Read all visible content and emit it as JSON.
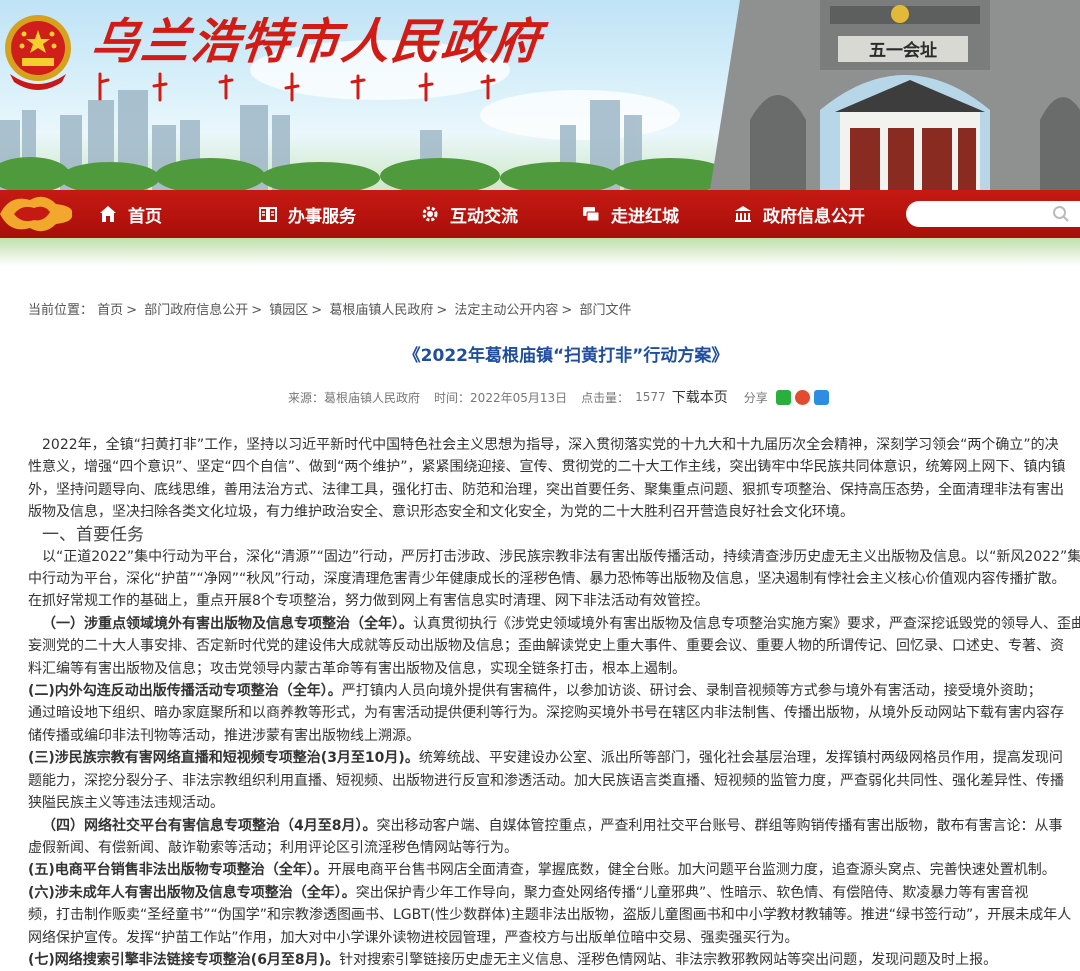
{
  "header": {
    "site_title": "乌兰浩特市人民政府",
    "gate_sign": "五一会址"
  },
  "nav": {
    "items": [
      {
        "label": "首页",
        "icon": "home-icon"
      },
      {
        "label": "办事服务",
        "icon": "book-icon"
      },
      {
        "label": "互动交流",
        "icon": "gear-icon"
      },
      {
        "label": "走进红城",
        "icon": "chat-icon"
      },
      {
        "label": "政府信息公开",
        "icon": "building-icon"
      }
    ],
    "search_placeholder": ""
  },
  "breadcrumb": {
    "label": "当前位置：",
    "items": [
      "首页",
      "部门政府信息公开",
      "镇园区",
      "葛根庙镇人民政府",
      "法定主动公开内容",
      "部门文件"
    ]
  },
  "article": {
    "title": "《2022年葛根庙镇“扫黄打非”行动方案》",
    "meta": {
      "source_label": "来源：",
      "source": "葛根庙镇人民政府",
      "time_label": "时间：",
      "time": "2022年05月13日",
      "clicks_label": "点击量：",
      "clicks": "1577",
      "download": "下载本页",
      "share": "分享"
    },
    "intro": [
      "2022年，全镇“扫黄打非”工作，坚持以习近平新时代中国特色社会主义思想为指导，深入贯彻落实党的十九大和十九届历次全会精神，深刻学习领会“两个确立”的决",
      "性意义，增强“四个意识”、坚定“四个自信”、做到“两个维护”，紧紧围绕迎接、宣传、贯彻党的二十大工作主线，突出铸牢中华民族共同体意识，统筹网上网下、镇内镇",
      "外，坚持问题导向、底线思维，善用法治方式、法律工具，强化打击、防范和治理，突出首要任务、聚集重点问题、狠抓专项整治、保持高压态势，全面清理非法有害出",
      "版物及信息，坚决扫除各类文化垃圾，有力维护政治安全、意识形态安全和文化安全，为党的二十大胜利召开营造良好社会文化环境。"
    ],
    "section1_heading": "一、首要任务",
    "section1_para": [
      "以“正道2022”集中行动为平台，深化“清源”“固边”行动，严厉打击涉政、涉民族宗教非法有害出版传播活动，持续清查涉历史虚无主义出版物及信息。以“新风2022”集",
      "中行动为平台，深化“护苗”“净网”“秋风”行动，深度清理危害青少年健康成长的淫秽色情、暴力恐怖等出版物及信息，坚决遏制有悖社会主义核心价值观内容传播扩散。",
      "在抓好常规工作的基础上，重点开展8个专项整治，努力做到网上有害信息实时清理、网下非法活动有效管控。"
    ],
    "items": [
      {
        "head": "（一）涉重点领域境外有害出版物及信息专项整治（全年）。",
        "lines": [
          "认真贯彻执行《涉党史领域境外有害出版物及信息专项整治实施方案》要求，严查深挖诋毁党的领导人、歪曲",
          "妄测党的二十大人事安排、否定新时代党的建设伟大成就等反动出版物及信息；歪曲解读党史上重大事件、重要会议、重要人物的所谓传记、回忆录、口述史、专著、资",
          "料汇编等有害出版物及信息；攻击党领导内蒙古革命等有害出版物及信息，实现全链条打击，根本上遏制。"
        ]
      },
      {
        "head": "(二)内外勾连反动出版传播活动专项整治（全年）。",
        "lines": [
          "严打镇内人员向境外提供有害稿件，以参加访谈、研讨会、录制音视频等方式参与境外有害活动，接受境外资助；",
          "通过暗设地下组织、暗办家庭聚所和以商养教等形式，为有害活动提供便利等行为。深挖购买境外书号在辖区内非法制售、传播出版物，从境外反动网站下载有害内容存",
          "储传播或编印非法刊物等活动，推进涉蒙有害出版物线上溯源。"
        ]
      },
      {
        "head": "(三)涉民族宗教有害网络直播和短视频专项整治(3月至10月)。",
        "lines": [
          "统筹统战、平安建设办公室、派出所等部门，强化社会基层治理，发挥镇村两级网格员作用，提高发现问",
          "题能力，深挖分裂分子、非法宗教组织利用直播、短视频、出版物进行反宣和渗透活动。加大民族语言类直播、短视频的监管力度，严查弱化共同性、强化差异性、传播",
          "狭隘民族主义等违法违规活动。"
        ]
      },
      {
        "head": "（四）网络社交平台有害信息专项整治（4月至8月）。",
        "lines": [
          "突出移动客户端、自媒体管控重点，严查利用社交平台账号、群组等购销传播有害出版物，散布有害言论：从事",
          "虚假新闻、有偿新闻、敲诈勒索等活动；利用评论区引流淫秽色情网站等行为。"
        ]
      },
      {
        "head": "(五)电商平台销售非法出版物专项整治（全年）。",
        "lines": [
          "开展电商平台售书网店全面清查，掌握底数，健全台账。加大问题平台监测力度，追查源头窝点、完善快速处置机制。"
        ]
      },
      {
        "head": "(六)涉未成年人有害出版物及信息专项整治（全年）。",
        "lines": [
          "突出保护青少年工作导向，聚力查处网络传播“儿童邪典”、性暗示、软色情、有偿陪侍、欺凌暴力等有害音视",
          "频，打击制作贩卖“圣经童书”“伪国学”和宗教渗透图画书、LGBT(性少数群体)主题非法出版物，盗版儿童图画书和中小学教材教辅等。推进“绿书签行动”，开展未成年人",
          "网络保护宣传。发挥“护苗工作站”作用，加大对中小学课外读物进校园管理，严查校方与出版单位暗中交易、强卖强买行为。"
        ]
      },
      {
        "head": "(七)网络搜索引擎非法链接专项整治(6月至8月)。",
        "lines": [
          "针对搜索引擎链接历史虚无主义信息、淫秽色情网站、非法宗教邪教网站等突出问题，发现问题及时上报。"
        ]
      }
    ]
  },
  "colors": {
    "nav_red": "#b8130d",
    "title_blue": "#1f4e9c",
    "site_title_red": "#d11b14"
  }
}
